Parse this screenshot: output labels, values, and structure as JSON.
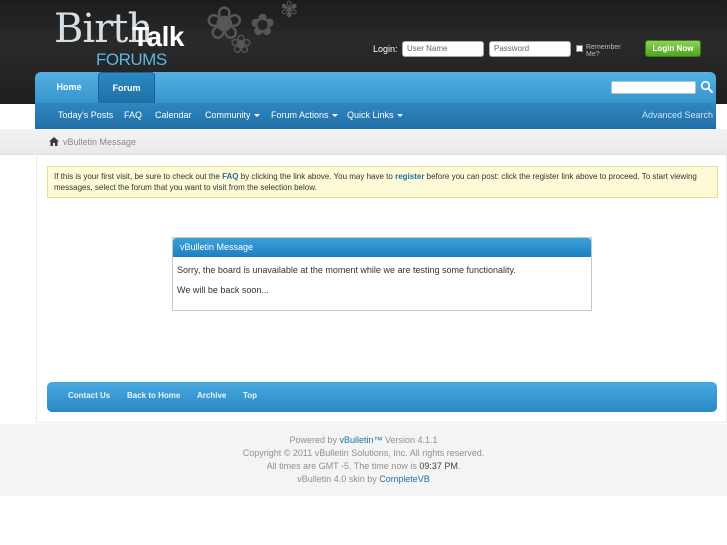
{
  "header": {
    "logo_text_birth": "Birth",
    "logo_text_talk": "Talk",
    "logo_text_forums": "FORUMS",
    "login_label": "Login:",
    "username_placeholder": "User Name",
    "password_placeholder": "Password",
    "remember_label": "Remember Me?",
    "login_button": "Login Now"
  },
  "nav": {
    "tabs": [
      {
        "label": "Home"
      },
      {
        "label": "Forum"
      }
    ],
    "subitems": [
      {
        "label": "Today's Posts"
      },
      {
        "label": "FAQ"
      },
      {
        "label": "Calendar"
      },
      {
        "label": "Community"
      },
      {
        "label": "Forum Actions"
      },
      {
        "label": "Quick Links"
      }
    ],
    "advanced_search": "Advanced Search"
  },
  "breadcrumb": {
    "current": "vBulletin Message"
  },
  "notice": {
    "t1": "If this is your first visit, be sure to check out the ",
    "faq": "FAQ",
    "t2": " by clicking the link above. You may have to ",
    "register": "register",
    "t3": " before you can post: click the register link above to proceed. To start viewing messages, select the forum that you want to visit from the selection below."
  },
  "message": {
    "title": "vBulletin Message",
    "line1": "Sorry, the board is unavailable at the moment while we are testing some functionality.",
    "line2": "We will be back soon..."
  },
  "footer_nav": [
    {
      "label": "Contact Us"
    },
    {
      "label": "Back to Home"
    },
    {
      "label": "Archive"
    },
    {
      "label": "Top"
    }
  ],
  "copyright": {
    "powered_pre": "Powered by ",
    "powered_link": "vBulletin™",
    "powered_post": " Version 4.1.1",
    "copyright_line": "Copyright © 2011 vBulletin Solutions, Inc. All rights reserved.",
    "times_pre": "All times are GMT -5. The time now is ",
    "time_now": "09:37 PM",
    "times_post": ".",
    "skin_pre": "vBulletin 4.0 skin by ",
    "skin_link": "CompleteVB"
  },
  "colors": {
    "nav_blue": "#3594cc",
    "link_blue": "#1f6fa3",
    "login_green": "#4fa51e",
    "notice_bg": "#fdfbd7"
  }
}
